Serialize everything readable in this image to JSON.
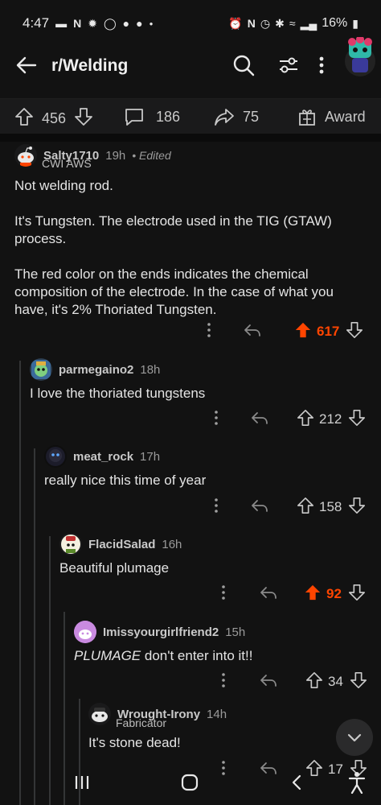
{
  "status_bar": {
    "time": "4:47",
    "battery": "16%"
  },
  "header": {
    "subreddit": "r/Welding"
  },
  "post_actions": {
    "upvotes": "456",
    "comments": "186",
    "shares": "75",
    "award_label": "Award"
  },
  "comments": [
    {
      "user": "Salty1710",
      "time": "19h",
      "edited": "• Edited",
      "flair": "CWI AWS",
      "body": "Not welding rod.\n\nIt's Tungsten.  The electrode used in the TIG (GTAW) process.\n\nThe red color on the ends indicates the chemical composition of the electrode. In the case of what you have, it's 2% Thoriated Tungsten.",
      "score": "617",
      "upvoted": true
    },
    {
      "user": "parmegaino2",
      "time": "18h",
      "body": "I love the thoriated tungstens",
      "score": "212",
      "upvoted": false
    },
    {
      "user": "meat_rock",
      "time": "17h",
      "body": "really nice this time of year",
      "score": "158",
      "upvoted": false
    },
    {
      "user": "FlacidSalad",
      "time": "16h",
      "body": "Beautiful plumage",
      "score": "92",
      "upvoted": true
    },
    {
      "user": "Imissyourgirlfriend2",
      "time": "15h",
      "body_em": "PLUMAGE",
      "body_rest": " don't enter into it!!",
      "score": "34",
      "upvoted": false
    },
    {
      "user": "Wrought-Irony",
      "time": "14h",
      "flair": "Fabricator",
      "body": "It's stone dead!",
      "score": "17",
      "upvoted": false
    }
  ],
  "colors": {
    "background": "#121212",
    "upvote_active": "#ff4500",
    "thread_line": "#343536"
  },
  "icons": [
    "back-arrow-icon",
    "search-icon",
    "filter-icon",
    "more-icon",
    "upvote-icon",
    "downvote-icon",
    "comment-icon",
    "share-icon",
    "award-icon",
    "reply-icon",
    "chevron-down-icon"
  ]
}
